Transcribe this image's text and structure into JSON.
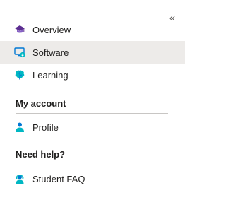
{
  "collapse_glyph": "«",
  "nav": {
    "items": [
      {
        "label": "Overview",
        "icon": "graduation-cap-icon",
        "active": false
      },
      {
        "label": "Software",
        "icon": "monitor-download-icon",
        "active": true
      },
      {
        "label": "Learning",
        "icon": "brain-icon",
        "active": false
      }
    ]
  },
  "my_account": {
    "header": "My account",
    "items": [
      {
        "label": "Profile",
        "icon": "person-icon"
      }
    ]
  },
  "need_help": {
    "header": "Need help?",
    "items": [
      {
        "label": "Student FAQ",
        "icon": "support-agent-icon"
      }
    ]
  },
  "colors": {
    "active_bg": "#edebe9",
    "divider": "#c8c6c4",
    "icon_purple": "#5c2d91",
    "icon_blue": "#0078d4",
    "icon_teal": "#00b7c3"
  }
}
